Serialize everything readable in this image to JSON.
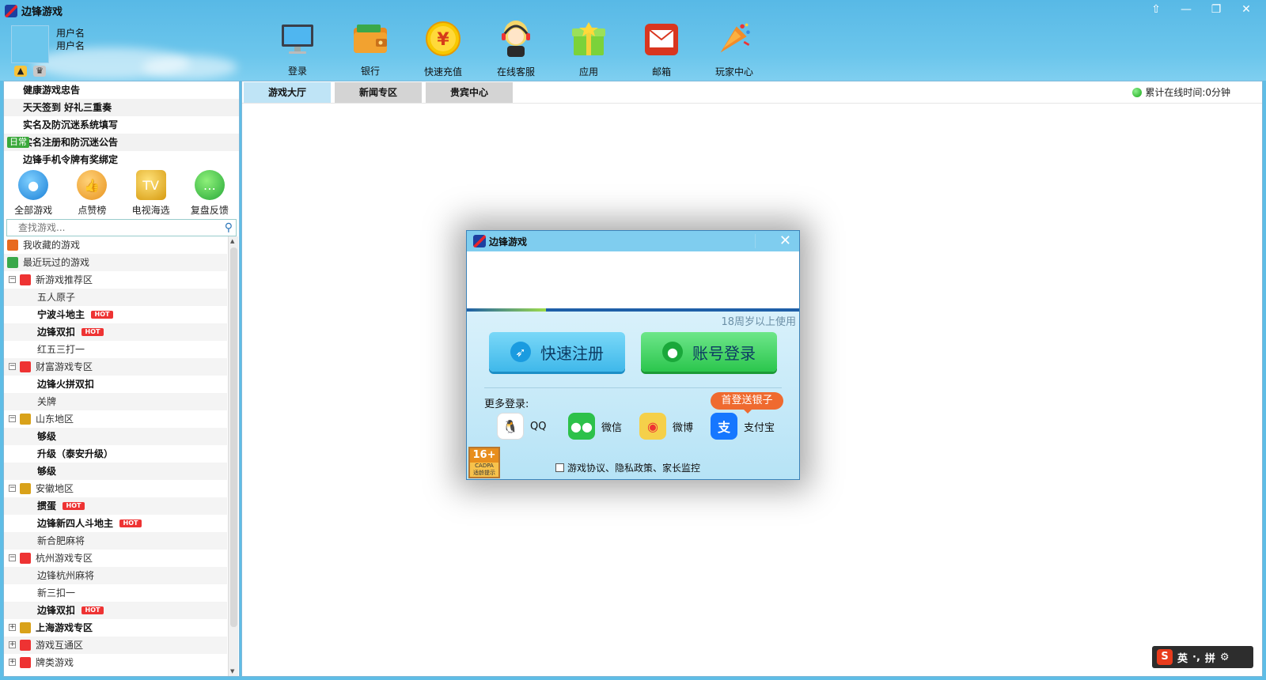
{
  "app": {
    "title": "边锋游戏"
  },
  "window_controls": [
    "⇧",
    "—",
    "❐",
    "✕"
  ],
  "user": {
    "name1": "用户名",
    "name2": "用户名"
  },
  "toolbar": [
    {
      "label": "登录",
      "icon": "monitor-icon"
    },
    {
      "label": "银行",
      "icon": "wallet-icon"
    },
    {
      "label": "快速充值",
      "icon": "yen-coin-icon",
      "glyph": "¥"
    },
    {
      "label": "在线客服",
      "icon": "headset-agent-icon"
    },
    {
      "label": "应用",
      "icon": "gift-box-icon"
    },
    {
      "label": "邮箱",
      "icon": "mail-icon"
    },
    {
      "label": "玩家中心",
      "icon": "party-horn-icon"
    }
  ],
  "notices": [
    {
      "text": "健康游戏忠告"
    },
    {
      "text": "天天签到 好礼三重奏"
    },
    {
      "text": "实名及防沉迷系统填写"
    },
    {
      "text": "实名注册和防沉迷公告",
      "badge": "日常"
    },
    {
      "text": "边锋手机令牌有奖绑定"
    }
  ],
  "quick_icons": [
    {
      "label": "全部游戏",
      "icon": "joystick-icon"
    },
    {
      "label": "点赞榜",
      "icon": "thumbs-up-icon"
    },
    {
      "label": "电视海选",
      "icon": "trophy-tv-icon"
    },
    {
      "label": "复盘反馈",
      "icon": "chat-bubble-icon"
    }
  ],
  "search": {
    "placeholder": "查找游戏..."
  },
  "tree": [
    {
      "label": "我收藏的游戏",
      "level": 0,
      "icon": "favorite-icon"
    },
    {
      "label": "最近玩过的游戏",
      "level": 0,
      "icon": "recent-icon"
    },
    {
      "label": "新游戏推荐区",
      "level": 0,
      "toggle": "⊟",
      "icon": "house-icon"
    },
    {
      "label": "五人原子",
      "level": 1
    },
    {
      "label": "宁波斗地主",
      "level": 1,
      "bold": true,
      "hot": "HOT"
    },
    {
      "label": "边锋双扣",
      "level": 1,
      "bold": true,
      "hot": "HOT"
    },
    {
      "label": "红五三打一",
      "level": 1
    },
    {
      "label": "财富游戏专区",
      "level": 0,
      "toggle": "⊟",
      "icon": "house-icon"
    },
    {
      "label": "边锋火拼双扣",
      "level": 1,
      "bold": true
    },
    {
      "label": "关牌",
      "level": 1
    },
    {
      "label": "山东地区",
      "level": 0,
      "toggle": "⊟",
      "icon": "region-icon"
    },
    {
      "label": "够级",
      "level": 1,
      "bold": true
    },
    {
      "label": "升级（泰安升级）",
      "level": 1,
      "bold": true
    },
    {
      "label": "够级",
      "level": 1,
      "bold": true
    },
    {
      "label": "安徽地区",
      "level": 0,
      "toggle": "⊟",
      "icon": "region-icon"
    },
    {
      "label": "掼蛋",
      "level": 1,
      "bold": true,
      "hot": "HOT"
    },
    {
      "label": "边锋新四人斗地主",
      "level": 1,
      "bold": true,
      "hot": "HOT"
    },
    {
      "label": "新合肥麻将",
      "level": 1
    },
    {
      "label": "杭州游戏专区",
      "level": 0,
      "toggle": "⊟",
      "icon": "house-icon"
    },
    {
      "label": "边锋杭州麻将",
      "level": 1
    },
    {
      "label": "新三扣一",
      "level": 1
    },
    {
      "label": "边锋双扣",
      "level": 1,
      "bold": true,
      "hot": "HOT"
    },
    {
      "label": "上海游戏专区",
      "level": 0,
      "toggle": "⊞",
      "icon": "region-icon",
      "bold": true
    },
    {
      "label": "游戏互通区",
      "level": 0,
      "toggle": "⊞",
      "icon": "house-icon"
    },
    {
      "label": "牌类游戏",
      "level": 0,
      "toggle": "⊞",
      "icon": "house-icon"
    }
  ],
  "tabs": [
    {
      "label": "游戏大厅",
      "active": true
    },
    {
      "label": "新闻专区",
      "active": false
    },
    {
      "label": "贵宾中心",
      "active": false
    }
  ],
  "status": {
    "online_time": "累计在线时间:0分钟"
  },
  "dialog": {
    "title": "边锋游戏",
    "close": "✕",
    "age_notice": "18周岁以上使用",
    "register_label": "快速注册",
    "login_label": "账号登录",
    "more_login": "更多登录:",
    "promo": "首登送银子",
    "socials": [
      {
        "label": "QQ",
        "icon": "qq-penguin-icon",
        "color": "#ffffff"
      },
      {
        "label": "微信",
        "icon": "wechat-icon",
        "color": "#2dc14a"
      },
      {
        "label": "微博",
        "icon": "weibo-icon",
        "color": "#f5d04a"
      },
      {
        "label": "支付宝",
        "icon": "alipay-icon",
        "color": "#1677ff",
        "glyph": "支"
      }
    ],
    "age_rating": "16+",
    "cadpa": "CADPA",
    "rating_label": "适龄提示",
    "agreement": "游戏协议、隐私政策、家长监控"
  },
  "ime": {
    "brand": "S",
    "mode": "英",
    "dots": "·,",
    "pinyin": "拼",
    "gear": "⚙"
  }
}
